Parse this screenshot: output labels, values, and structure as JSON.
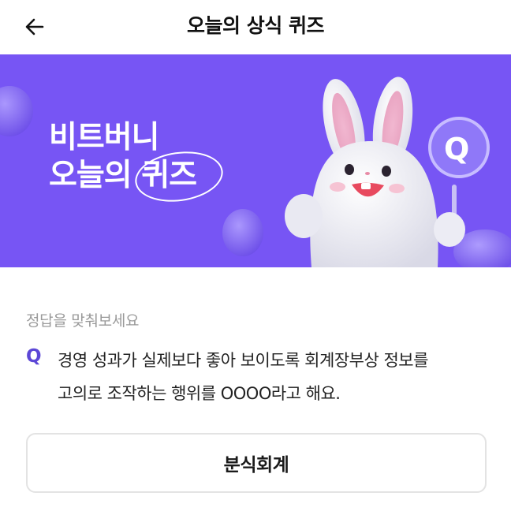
{
  "header": {
    "title": "오늘의 상식 퀴즈",
    "back_icon": "arrow-left-icon"
  },
  "banner": {
    "line1": "비트버니",
    "line2_prefix": "오늘의",
    "line2_highlight": "퀴즈",
    "badge_letter": "Q",
    "background_color": "#7755f4"
  },
  "quiz": {
    "hint": "정답을 맞춰보세요",
    "q_mark": "Q",
    "question_line1": "경영 성과가 실제보다 좋아 보이도록 회계장부상 정보를",
    "question_line2": "고의로 조작하는 행위를 OOOO라고 해요."
  },
  "answers": [
    {
      "label": "분식회계"
    }
  ]
}
